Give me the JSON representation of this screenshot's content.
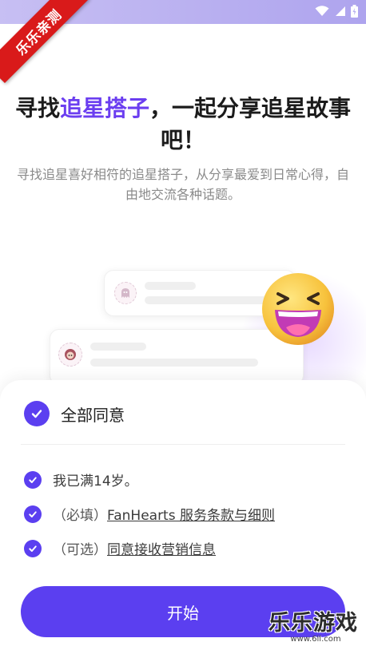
{
  "ribbon": "乐乐亲测",
  "headline": {
    "part1": "寻找",
    "accent": "追星搭子",
    "part2": "，一起分享追星故事吧！"
  },
  "subtext": "寻找追星喜好相符的追星搭子，从分享最爱到日常心得，自由地交流各种话题。",
  "consent": {
    "all_label": "全部同意",
    "age_label": "我已满14岁。",
    "terms_prefix": "（必填）",
    "terms_link": "FanHearts 服务条款与细则",
    "marketing_prefix": "（可选）",
    "marketing_link": "同意接收营销信息"
  },
  "start_button": "开始",
  "watermark": {
    "title": "乐乐游戏",
    "url": "www.6ll.com"
  },
  "colors": {
    "accent": "#5b3ff0",
    "ribbon": "#d91a1a"
  },
  "icons": [
    "wifi-icon",
    "signal-icon",
    "battery-icon",
    "checkmark-icon",
    "laughing-emoji-icon"
  ]
}
